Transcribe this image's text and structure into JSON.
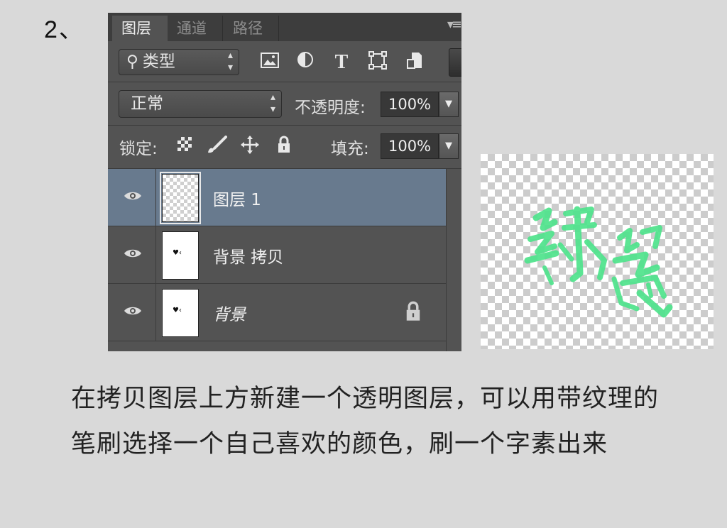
{
  "step_label": "2、",
  "panel": {
    "tabs": [
      {
        "label": "图层",
        "active": true
      },
      {
        "label": "通道",
        "active": false
      },
      {
        "label": "路径",
        "active": false
      }
    ],
    "menu_icon": "panel-menu-icon",
    "filter": {
      "search_icon": "search-icon",
      "value": "类型",
      "icons": [
        "image-filter-icon",
        "adjustment-filter-icon",
        "text-filter-icon",
        "shape-filter-icon",
        "smart-object-filter-icon"
      ],
      "text_icon_glyph": "T"
    },
    "blend_mode": "正常",
    "opacity_label": "不透明度:",
    "opacity_value": "100%",
    "lock_label": "锁定:",
    "lock_icons": [
      "lock-transparent-icon",
      "lock-paint-icon",
      "lock-position-icon",
      "lock-all-icon"
    ],
    "fill_label": "填充:",
    "fill_value": "100%",
    "layers": [
      {
        "name": "图层 1",
        "selected": true,
        "thumb": "transparent"
      },
      {
        "name": "背景 拷贝",
        "selected": false,
        "thumb": "white"
      },
      {
        "name": "背景",
        "selected": false,
        "thumb": "white",
        "locked": true
      }
    ]
  },
  "preview": {
    "description_icon": "brush-stroke-artwork",
    "stroke_color": "#4fe38c"
  },
  "caption": "在拷贝图层上方新建一个透明图层，可以用带纹理的笔刷选择一个自己喜欢的颜色，刷一个字素出来"
}
